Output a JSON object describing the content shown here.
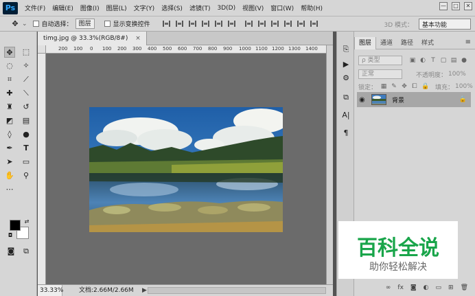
{
  "app": {
    "logo": "Ps"
  },
  "menu": [
    "文件(F)",
    "编辑(E)",
    "图像(I)",
    "图层(L)",
    "文字(Y)",
    "选择(S)",
    "滤镜(T)",
    "3D(D)",
    "视图(V)",
    "窗口(W)",
    "帮助(H)"
  ],
  "window_controls": {
    "minimize": "—",
    "restore": "□",
    "close": "✕"
  },
  "options": {
    "auto_select_label": "自动选择：",
    "auto_select_value": "图层",
    "transform_label": "显示变换控件",
    "mode_3d": "3D 模式：",
    "workspace": "基本功能"
  },
  "document": {
    "tab_title": "timg.jpg @ 33.3%(RGB/8#)",
    "close_glyph": "×",
    "zoom": "33.33%",
    "doc_info": "文档:2.66M/2.66M",
    "status_arrow": "▶"
  },
  "ruler": [
    "200",
    "100",
    "0",
    "100",
    "200",
    "300",
    "400",
    "500",
    "600",
    "700",
    "800",
    "900",
    "1000",
    "1100",
    "1200",
    "1300",
    "1400"
  ],
  "layers_panel": {
    "tabs": [
      "图层",
      "通道",
      "路径",
      "样式"
    ],
    "menu_glyph": "≡",
    "kind": "ρ 类型",
    "blend": "正常",
    "opacity_label": "不透明度：",
    "opacity_value": "100%",
    "lock_label": "锁定：",
    "fill_label": "填充：",
    "fill_value": "100%",
    "layer_name": "背景"
  },
  "watermark": {
    "title": "百科全说",
    "subtitle": "助你轻松解决"
  },
  "colors": {
    "accent": "#31a8ff",
    "watermark_green": "#19a54a",
    "selected_layer": "#a7a7a7"
  }
}
